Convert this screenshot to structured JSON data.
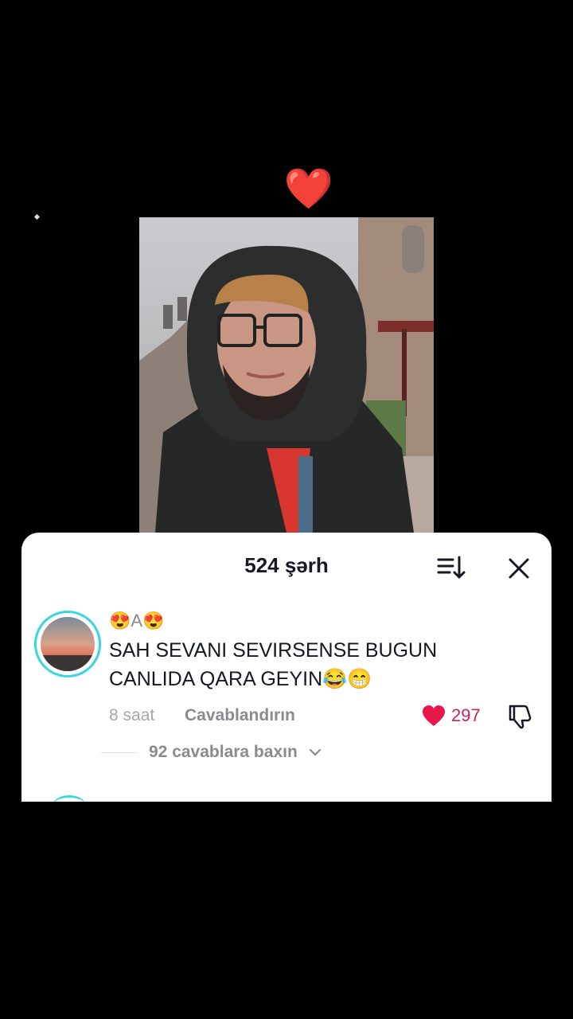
{
  "caption": {
    "emojis": [
      "😍",
      "❤️"
    ]
  },
  "photo": {
    "alt": "selfie"
  },
  "comments_sheet": {
    "title": "524 şərh",
    "sort_icon": "sort-icon",
    "close_icon": "close-icon",
    "comment": {
      "username": "😍A😍",
      "text": "SAH SEVANI SEVIRSENSE BUGUN CANLIDA QARA GEYIN😂😁",
      "time": "8 saat",
      "reply_label": "Cavablandırın",
      "like_count": "297",
      "liked": true,
      "like_color": "#e8174a",
      "view_replies_label": "92 cavablara baxın",
      "view_replies_icon": "chevron-down-icon"
    }
  },
  "colors": {
    "avatar_ring": "#38d6e0",
    "like_count_color": "#c6265a"
  }
}
